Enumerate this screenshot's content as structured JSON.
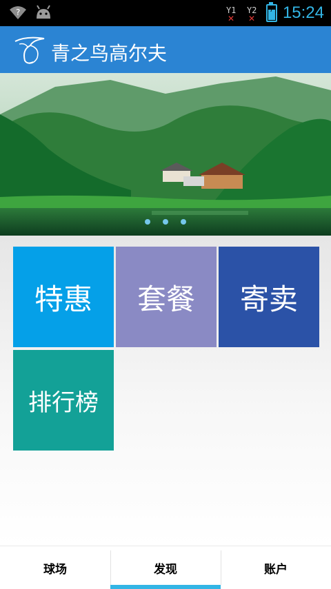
{
  "status_bar": {
    "sim1_label": "Y1",
    "sim2_label": "Y2",
    "time": "15:24",
    "icons": [
      "wifi-unknown-icon",
      "android-icon",
      "sim1-no-signal-icon",
      "sim2-no-signal-icon",
      "battery-charging-icon"
    ]
  },
  "header": {
    "title": "青之鸟高尔夫",
    "logo_icon": "bird-logo-icon",
    "color": "#2b84d3"
  },
  "banner": {
    "slide_count": 3
  },
  "tiles": [
    {
      "label": "特惠",
      "color": "#05a0e8"
    },
    {
      "label": "套餐",
      "color": "#8a8ac4"
    },
    {
      "label": "寄卖",
      "color": "#2b52a7"
    },
    {
      "label": "排行榜",
      "color": "#13a197"
    }
  ],
  "tabbar": {
    "tabs": [
      {
        "label": "球场",
        "active": false
      },
      {
        "label": "发现",
        "active": true
      },
      {
        "label": "账户",
        "active": false
      }
    ],
    "accent": "#33b5e5"
  }
}
